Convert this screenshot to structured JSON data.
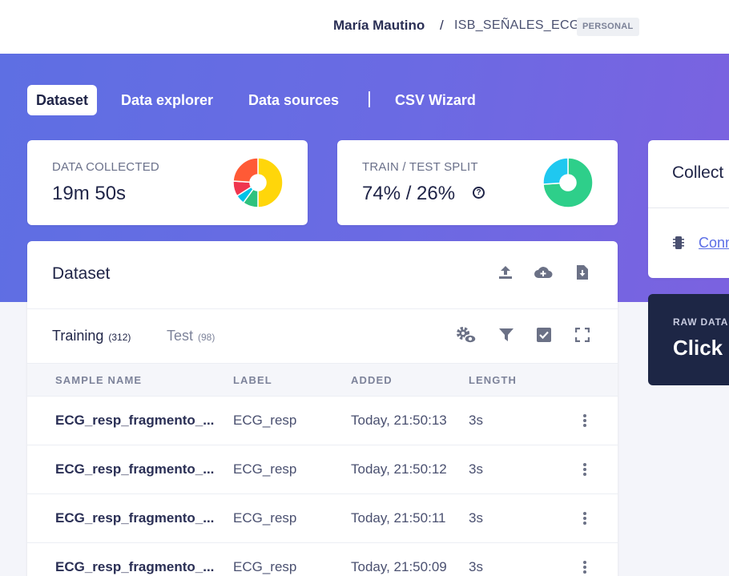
{
  "breadcrumb": {
    "user": "María Mautino",
    "separator": "/",
    "project": "ISB_SEÑALES_ECG",
    "badge": "PERSONAL"
  },
  "tabs": [
    {
      "label": "Dataset",
      "active": true
    },
    {
      "label": "Data explorer",
      "active": false
    },
    {
      "label": "Data sources",
      "active": false
    },
    {
      "label": "CSV Wizard",
      "active": false
    }
  ],
  "stats": {
    "data_collected": {
      "label": "DATA COLLECTED",
      "value": "19m 50s"
    },
    "train_test_split": {
      "label": "TRAIN / TEST SPLIT",
      "value": "74% / 26%",
      "help": "?"
    }
  },
  "charts": {
    "labels_donut": [
      {
        "value": 0.5,
        "color": "#ffd60a"
      },
      {
        "value": 0.1,
        "color": "#2ec27e"
      },
      {
        "value": 0.06,
        "color": "#00c2e8"
      },
      {
        "value": 0.1,
        "color": "#f0364f"
      },
      {
        "value": 0.24,
        "color": "#ff5a36"
      }
    ],
    "split_donut": [
      {
        "value": 0.74,
        "color": "#2ecf8a"
      },
      {
        "value": 0.26,
        "color": "#1fc8f0"
      }
    ]
  },
  "collect_panel": {
    "title": "Collect",
    "link": "Conn"
  },
  "raw_panel": {
    "label": "RAW DATA",
    "text": "Click on"
  },
  "dataset": {
    "title": "Dataset",
    "subtabs": [
      {
        "label": "Training",
        "count": "(312)",
        "active": true
      },
      {
        "label": "Test",
        "count": "(98)",
        "active": false
      }
    ],
    "columns": [
      "SAMPLE NAME",
      "LABEL",
      "ADDED",
      "LENGTH"
    ],
    "rows": [
      {
        "name": "ECG_resp_fragmento_...",
        "label": "ECG_resp",
        "added": "Today, 21:50:13",
        "length": "3s"
      },
      {
        "name": "ECG_resp_fragmento_...",
        "label": "ECG_resp",
        "added": "Today, 21:50:12",
        "length": "3s"
      },
      {
        "name": "ECG_resp_fragmento_...",
        "label": "ECG_resp",
        "added": "Today, 21:50:11",
        "length": "3s"
      },
      {
        "name": "ECG_resp_fragmento_...",
        "label": "ECG_resp",
        "added": "Today, 21:50:09",
        "length": "3s"
      }
    ]
  },
  "colors": {
    "accent": "#5b6ee6",
    "dark_card": "#1d2645",
    "text": "#1f2447"
  }
}
